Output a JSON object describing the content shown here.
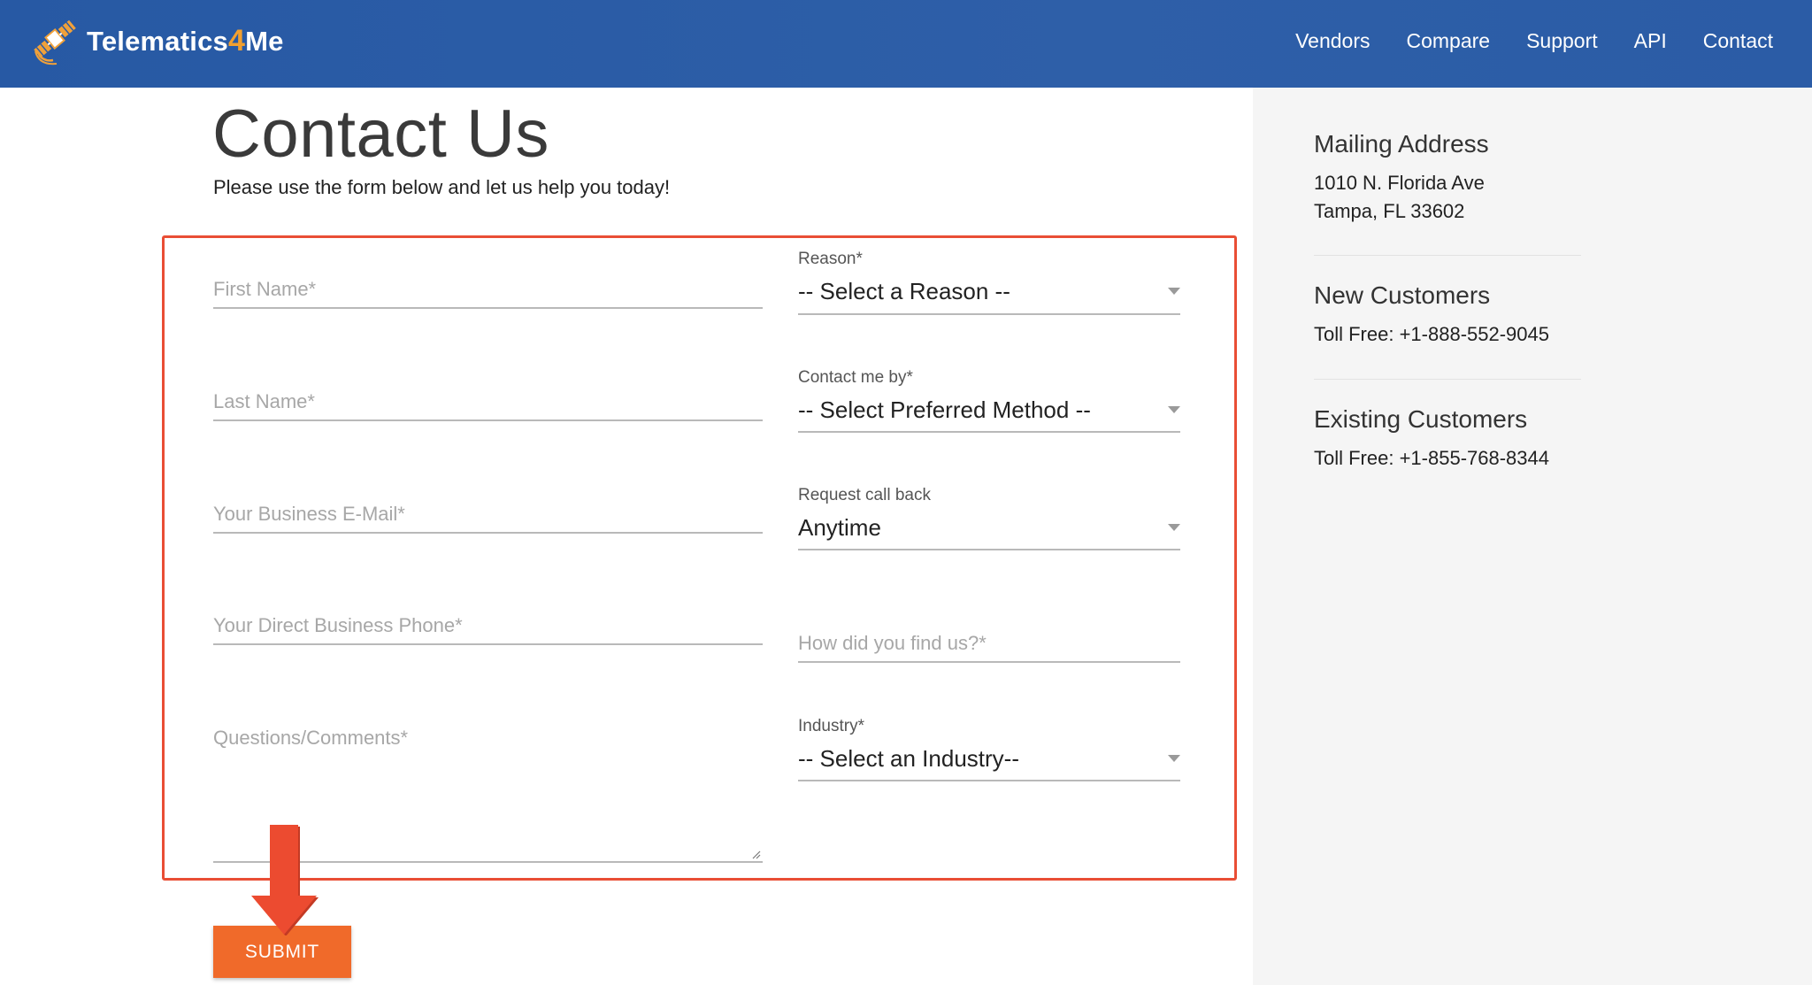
{
  "header": {
    "logo_main": "Telematics",
    "logo_four": "4",
    "logo_end": "Me",
    "nav": [
      "Vendors",
      "Compare",
      "Support",
      "API",
      "Contact"
    ]
  },
  "page": {
    "title": "Contact Us",
    "subtitle": "Please use the form below and let us help you today!"
  },
  "form": {
    "first_name_placeholder": "First Name*",
    "last_name_placeholder": "Last Name*",
    "email_placeholder": "Your Business E-Mail*",
    "phone_placeholder": "Your Direct Business Phone*",
    "comments_placeholder": "Questions/Comments*",
    "reason_label": "Reason*",
    "reason_value": "-- Select a Reason --",
    "contact_label": "Contact me by*",
    "contact_value": "-- Select Preferred Method --",
    "callback_label": "Request call back",
    "callback_value": "Anytime",
    "find_placeholder": "How did you find us?*",
    "industry_label": "Industry*",
    "industry_value": "-- Select an Industry--",
    "submit_label": "SUBMIT"
  },
  "sidebar": {
    "mailing_title": "Mailing Address",
    "mailing_line1": "1010 N. Florida Ave",
    "mailing_line2": "Tampa, FL 33602",
    "new_title": "New Customers",
    "new_phone": "Toll Free: +1-888-552-9045",
    "existing_title": "Existing Customers",
    "existing_phone": "Toll Free: +1-855-768-8344"
  },
  "colors": {
    "header_blue": "#2b5ca6",
    "accent_orange": "#f06a2a",
    "highlight_red": "#e94e35"
  }
}
